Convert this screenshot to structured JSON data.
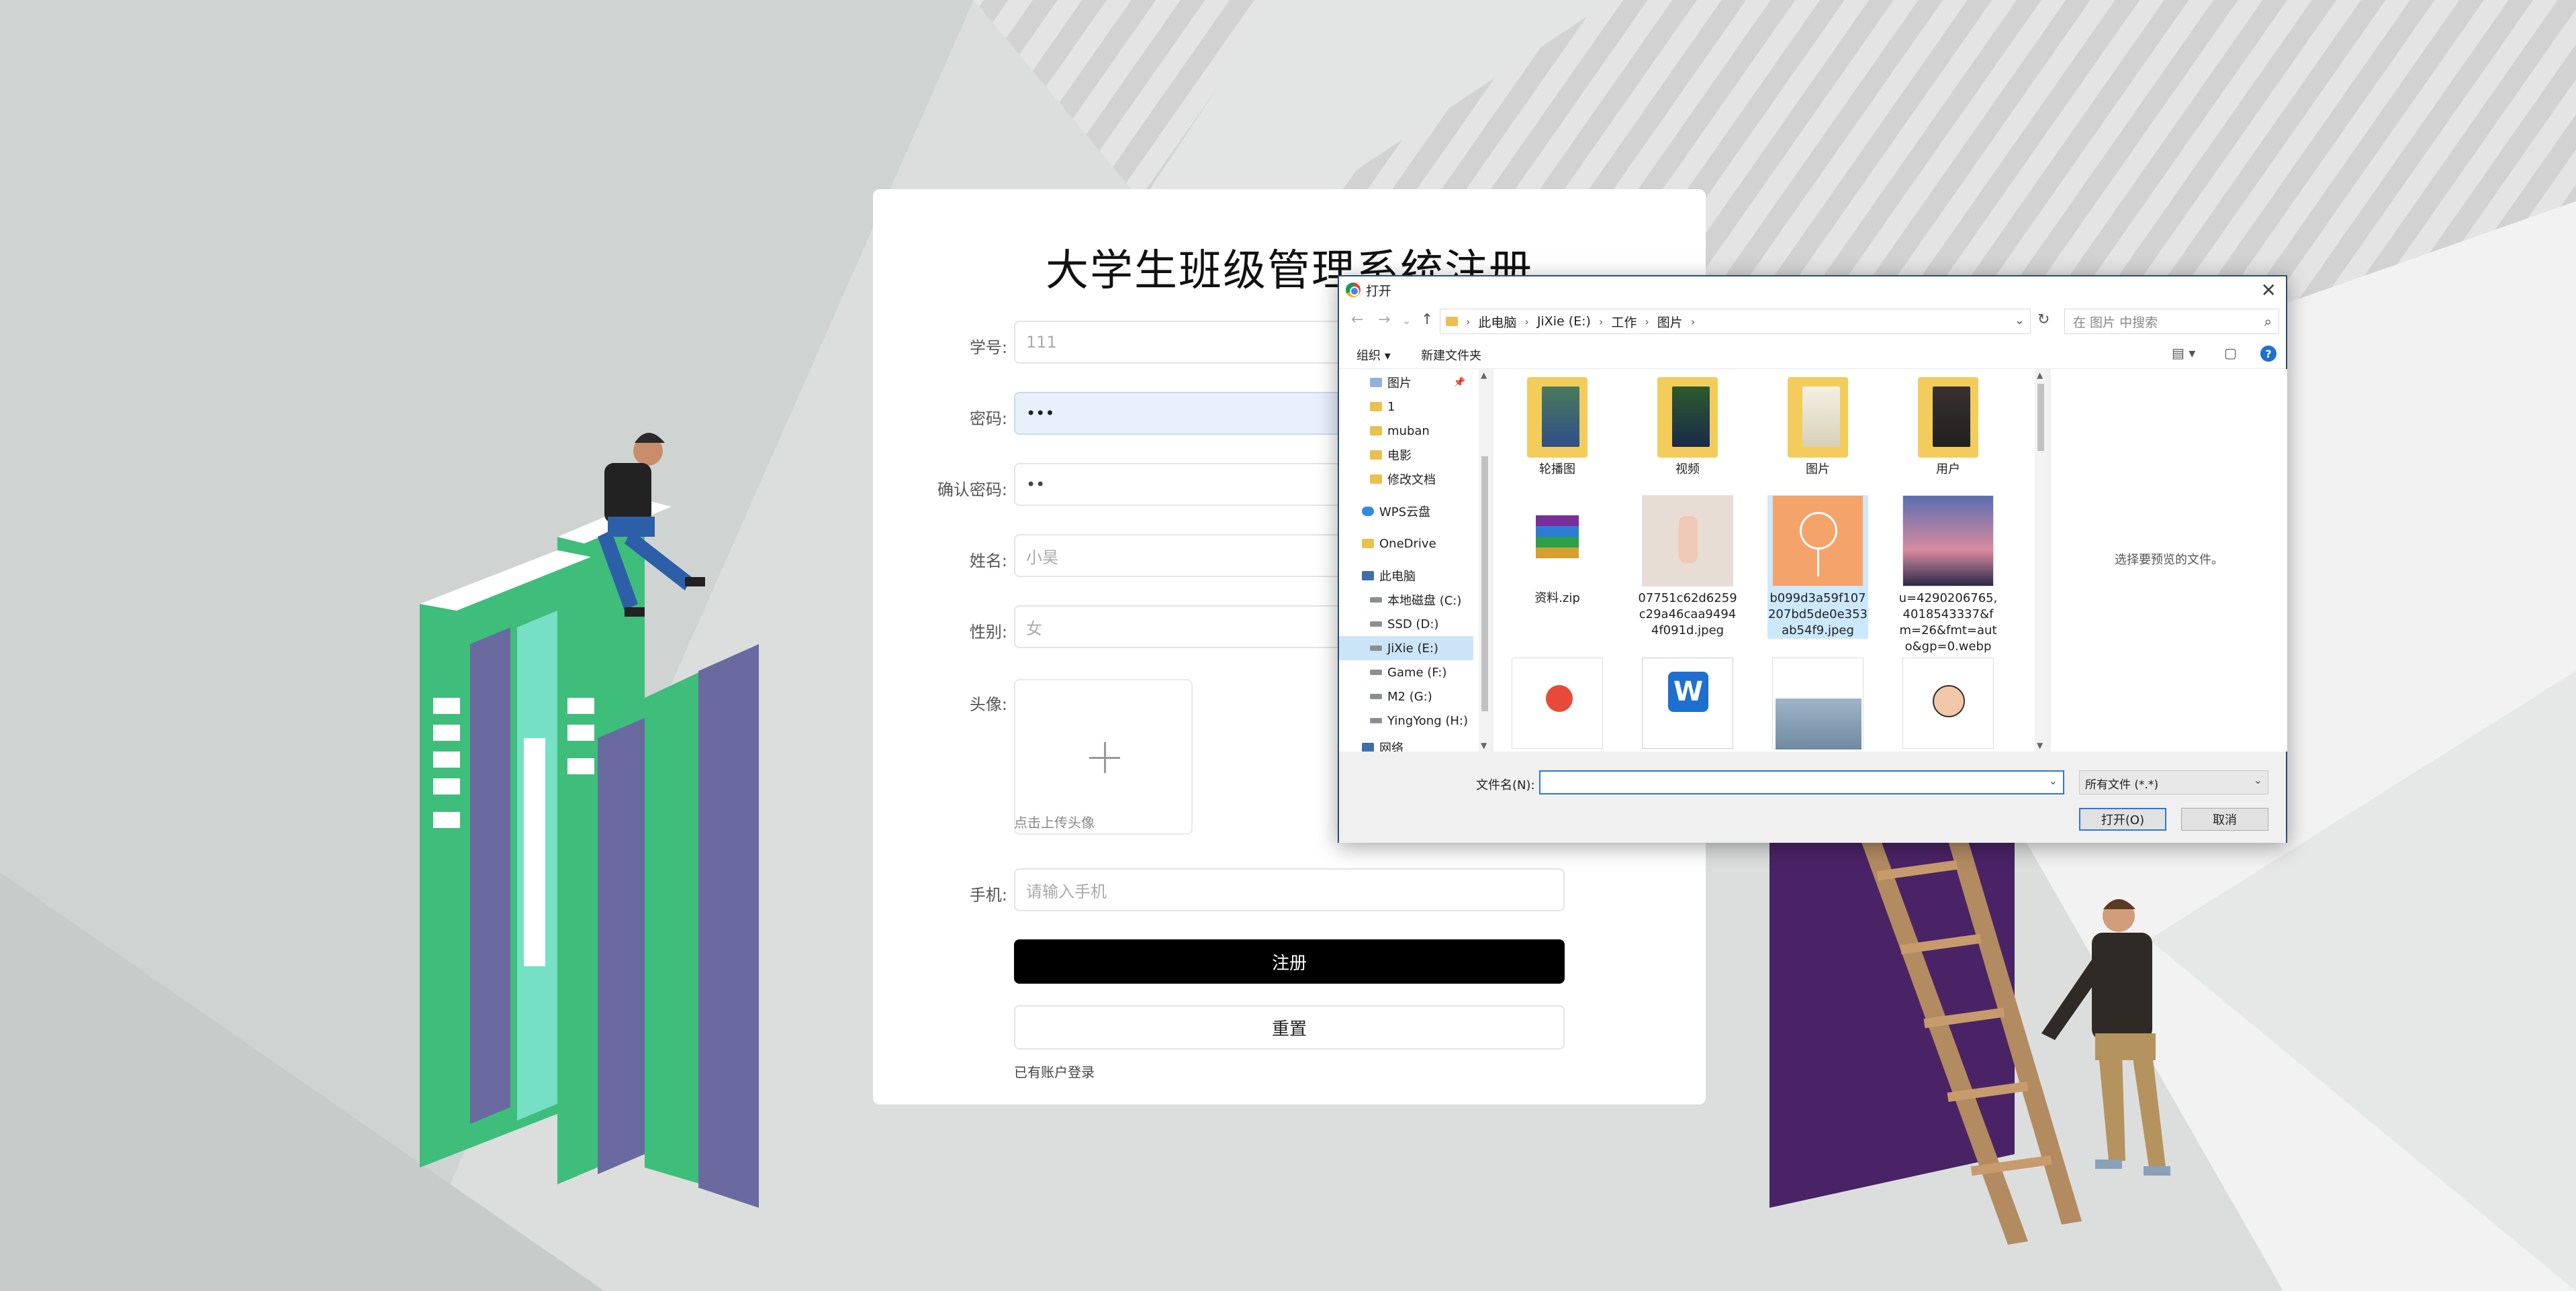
{
  "form": {
    "title": "大学生班级管理系统注册",
    "fields": {
      "student_id": {
        "label": "学号:",
        "value": "111"
      },
      "password": {
        "label": "密码:",
        "value": "•••"
      },
      "confirm_password": {
        "label": "确认密码:",
        "value": "••"
      },
      "name": {
        "label": "姓名:",
        "value": "小昊"
      },
      "gender": {
        "label": "性别:",
        "value": "女"
      },
      "avatar": {
        "label": "头像:",
        "hint": "点击上传头像"
      },
      "phone": {
        "label": "手机:",
        "placeholder": "请输入手机"
      }
    },
    "register_button": "注册",
    "reset_button": "重置",
    "login_link": "已有账户登录"
  },
  "dialog": {
    "title": "打开",
    "breadcrumb": [
      "此电脑",
      "JiXie (E:)",
      "工作",
      "图片"
    ],
    "search_placeholder": "在 图片 中搜索",
    "toolbar": {
      "organize": "组织 ▾",
      "new_folder": "新建文件夹"
    },
    "nav_items": [
      {
        "label": "图片",
        "icon": "folder-icon",
        "pinned": true
      },
      {
        "label": "1",
        "icon": "folder-icon"
      },
      {
        "label": "muban",
        "icon": "folder-icon"
      },
      {
        "label": "电影",
        "icon": "folder-icon"
      },
      {
        "label": "修改文档",
        "icon": "folder-icon"
      },
      {
        "label": "WPS云盘",
        "icon": "cloud-icon"
      },
      {
        "label": "OneDrive",
        "icon": "folder-icon"
      },
      {
        "label": "此电脑",
        "icon": "pc-icon"
      },
      {
        "label": "本地磁盘 (C:)",
        "icon": "drive-icon"
      },
      {
        "label": "SSD (D:)",
        "icon": "drive-icon"
      },
      {
        "label": "JiXie (E:)",
        "icon": "drive-icon",
        "selected": true
      },
      {
        "label": "Game (F:)",
        "icon": "drive-icon"
      },
      {
        "label": "M2 (G:)",
        "icon": "drive-icon"
      },
      {
        "label": "YingYong (H:)",
        "icon": "drive-icon"
      },
      {
        "label": "网络",
        "icon": "network-icon"
      }
    ],
    "files": [
      {
        "name": "轮播图",
        "kind": "folder"
      },
      {
        "name": "视频",
        "kind": "folder"
      },
      {
        "name": "图片",
        "kind": "folder"
      },
      {
        "name": "用户",
        "kind": "folder"
      },
      {
        "name": "资料.zip",
        "kind": "zip"
      },
      {
        "name": "07751c62d6259c29a46caa94944f091d.jpeg",
        "kind": "image"
      },
      {
        "name": "b099d3a59f107207bd5de0e353ab54f9.jpeg",
        "kind": "image",
        "selected": true
      },
      {
        "name": "u=4290206765,4018543337&fm=26&fmt=auto&gp=0.webp",
        "kind": "image"
      }
    ],
    "preview_text": "选择要预览的文件。",
    "filename_label": "文件名(N):",
    "filename_value": "",
    "filetype": "所有文件 (*.*)",
    "open_button": "打开(O)",
    "cancel_button": "取消"
  },
  "colors": {
    "register_bg": "#000000",
    "book_green": "#3dbb78",
    "book_purple": "#6a6aa0",
    "dialog_accent": "#2b79d3"
  }
}
